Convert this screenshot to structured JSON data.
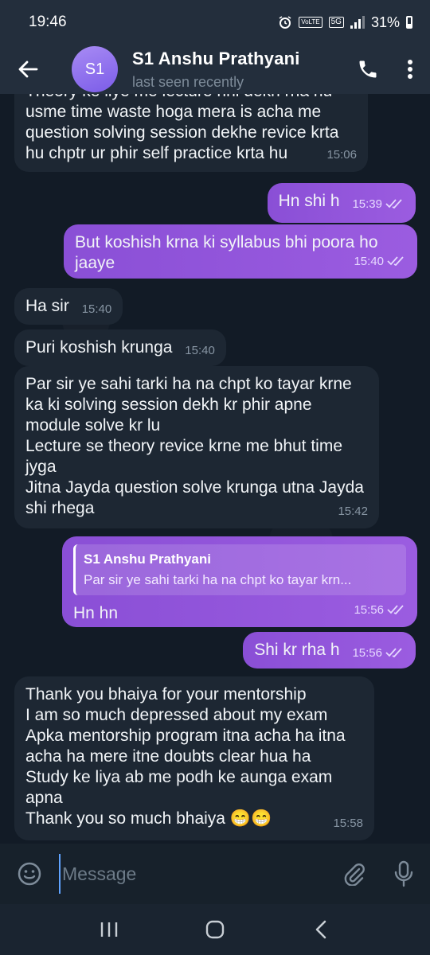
{
  "status_bar": {
    "time": "19:46",
    "battery": "31%",
    "network": "5G",
    "volte": "VoLTE"
  },
  "header": {
    "avatar_initials": "S1",
    "contact_name": "S1 Anshu Prathyani",
    "last_seen": "last seen recently"
  },
  "messages": [
    {
      "direction": "in",
      "text": "Theory ke liye me lecture nhi dekh rha hu usme time waste hoga mera is acha me question solving session dekhe revice krta hu chptr ur phir self practice krta hu",
      "time": "15:06"
    },
    {
      "direction": "out",
      "text": "Hn shi h",
      "time": "15:39",
      "status": "read"
    },
    {
      "direction": "out",
      "text": "But koshish krna ki syllabus bhi poora ho jaaye",
      "time": "15:40",
      "status": "read"
    },
    {
      "direction": "in",
      "text": "Ha sir",
      "time": "15:40"
    },
    {
      "direction": "in",
      "text": "Puri koshish krunga",
      "time": "15:40"
    },
    {
      "direction": "in",
      "text": "Par sir ye sahi tarki ha na chpt ko tayar krne ka ki solving session dekh kr phir apne module solve kr lu\nLecture se theory revice krne me bhut time jyga\nJitna Jayda question solve krunga utna Jayda shi rhega",
      "time": "15:42"
    },
    {
      "direction": "out",
      "reply_name": "S1 Anshu Prathyani",
      "reply_text": "Par sir ye sahi tarki ha na chpt ko tayar krn...",
      "text": "Hn hn",
      "time": "15:56",
      "status": "read"
    },
    {
      "direction": "out",
      "text": "Shi kr rha h",
      "time": "15:56",
      "status": "read"
    },
    {
      "direction": "in",
      "text": "Thank you bhaiya for your mentorship\nI am so much depressed about my exam\nApka mentorship program itna acha ha itna acha ha mere itne doubts clear hua ha\nStudy ke liya ab me podh ke aunga exam apna\nThank you so much bhaiya 😁😁",
      "time": "15:58"
    }
  ],
  "input": {
    "placeholder": "Message"
  },
  "icons": {
    "back": "arrow-left-icon",
    "call": "phone-icon",
    "menu": "more-vertical-icon",
    "emoji": "emoji-icon",
    "attach": "paperclip-icon",
    "mic": "microphone-icon",
    "nav_recents": "recents-icon",
    "nav_home": "home-icon",
    "nav_back": "nav-back-icon"
  },
  "colors": {
    "outgoing_bubble": "#9557dc",
    "incoming_bubble": "#1d2733",
    "header_bg": "#232e3c",
    "accent": "#5fa3ff"
  }
}
